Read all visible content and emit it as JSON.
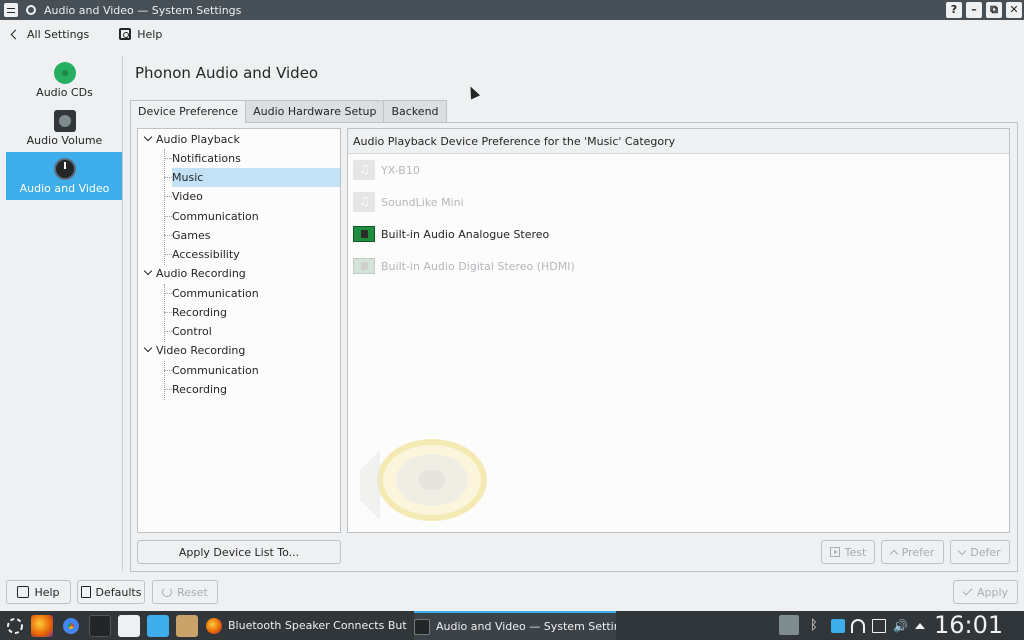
{
  "window": {
    "title": "Audio and Video — System Settings",
    "controls": [
      "?",
      "–",
      "⧉",
      "✕"
    ]
  },
  "nav": {
    "all_settings": "All Settings",
    "help": "Help"
  },
  "sidebar": {
    "items": [
      {
        "label": "Audio CDs",
        "icon": "audio-cd-icon",
        "selected": false
      },
      {
        "label": "Audio Volume",
        "icon": "audio-volume-icon",
        "selected": false
      },
      {
        "label": "Audio and Video",
        "icon": "audio-video-icon",
        "selected": true
      }
    ]
  },
  "page": {
    "title": "Phonon Audio and Video"
  },
  "tabs": [
    "Device Preference",
    "Audio Hardware Setup",
    "Backend"
  ],
  "active_tab": "Device Preference",
  "tree": {
    "groups": [
      {
        "label": "Audio Playback",
        "children": [
          "Notifications",
          "Music",
          "Video",
          "Communication",
          "Games",
          "Accessibility"
        ]
      },
      {
        "label": "Audio Recording",
        "children": [
          "Communication",
          "Recording",
          "Control"
        ]
      },
      {
        "label": "Video Recording",
        "children": [
          "Communication",
          "Recording"
        ]
      }
    ],
    "selected": "Music"
  },
  "device_list": {
    "header": "Audio Playback Device Preference for the 'Music' Category",
    "devices": [
      {
        "name": "YX-B10",
        "icon": "music-note-icon",
        "enabled": false
      },
      {
        "name": "SoundLike Mini",
        "icon": "music-note-icon",
        "enabled": false
      },
      {
        "name": "Built-in Audio Analogue Stereo",
        "icon": "sound-card-icon",
        "enabled": true
      },
      {
        "name": "Built-in Audio Digital Stereo (HDMI)",
        "icon": "sound-card-icon",
        "enabled": false
      }
    ]
  },
  "buttons": {
    "apply_device_list": "Apply Device List To...",
    "test": "Test",
    "prefer": "Prefer",
    "defer": "Defer",
    "help": "Help",
    "defaults": "Defaults",
    "reset": "Reset",
    "apply": "Apply"
  },
  "taskbar": {
    "tasks": [
      {
        "label": "Bluetooth Speaker Connects But N...",
        "icon": "firefox-icon",
        "active": false
      },
      {
        "label": "Audio and Video  — System Settings",
        "icon": "terminal-icon",
        "active": true
      }
    ],
    "clock": "16:01"
  },
  "colors": {
    "accent": "#3daee9",
    "titlebar": "#475057",
    "taskbar": "#31363b"
  }
}
